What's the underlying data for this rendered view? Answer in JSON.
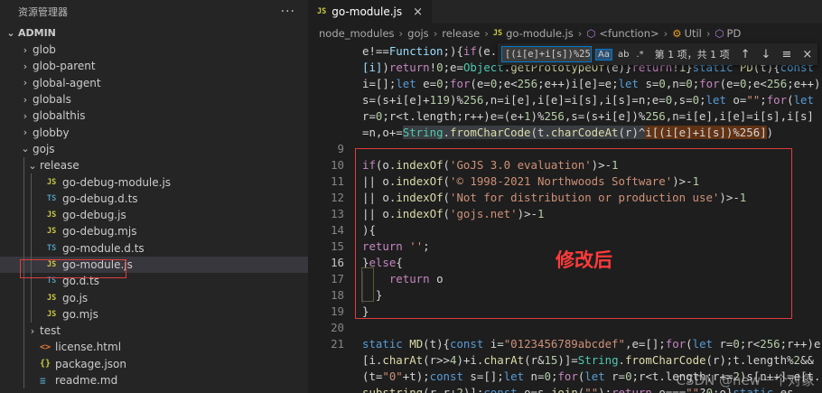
{
  "sidebar": {
    "title": "资源管理器",
    "more": "···",
    "section": "ADMIN",
    "items": [
      {
        "label": "glob",
        "depth": 1,
        "type": "folder",
        "open": false
      },
      {
        "label": "glob-parent",
        "depth": 1,
        "type": "folder",
        "open": false
      },
      {
        "label": "global-agent",
        "depth": 1,
        "type": "folder",
        "open": false
      },
      {
        "label": "globals",
        "depth": 1,
        "type": "folder",
        "open": false
      },
      {
        "label": "globalthis",
        "depth": 1,
        "type": "folder",
        "open": false
      },
      {
        "label": "globby",
        "depth": 1,
        "type": "folder",
        "open": false
      },
      {
        "label": "gojs",
        "depth": 1,
        "type": "folder",
        "open": true
      },
      {
        "label": "release",
        "depth": 2,
        "type": "folder",
        "open": true
      },
      {
        "label": "go-debug-module.js",
        "depth": 3,
        "type": "js"
      },
      {
        "label": "go-debug.d.ts",
        "depth": 3,
        "type": "ts"
      },
      {
        "label": "go-debug.js",
        "depth": 3,
        "type": "js"
      },
      {
        "label": "go-debug.mjs",
        "depth": 3,
        "type": "js"
      },
      {
        "label": "go-module.d.ts",
        "depth": 3,
        "type": "ts"
      },
      {
        "label": "go-module.js",
        "depth": 3,
        "type": "js",
        "selected": true
      },
      {
        "label": "go.d.ts",
        "depth": 3,
        "type": "ts"
      },
      {
        "label": "go.js",
        "depth": 3,
        "type": "js"
      },
      {
        "label": "go.mjs",
        "depth": 3,
        "type": "js"
      },
      {
        "label": "test",
        "depth": 2,
        "type": "folder",
        "open": false
      },
      {
        "label": "license.html",
        "depth": 2,
        "type": "html"
      },
      {
        "label": "package.json",
        "depth": 2,
        "type": "json"
      },
      {
        "label": "readme.md",
        "depth": 2,
        "type": "md"
      }
    ],
    "icon_text": {
      "js": "JS",
      "ts": "TS",
      "html": "<>",
      "json": "{}",
      "md": "≡"
    }
  },
  "editor": {
    "tab": {
      "label": "go-module.js",
      "icon": "JS",
      "close": "×"
    },
    "breadcrumb": [
      "node_modules",
      "gojs",
      "release",
      "go-module.js",
      "<function>",
      "Util",
      "PD"
    ],
    "find": {
      "query": "[(i[e]+i[s])%256])",
      "options": [
        "Aa",
        "ab",
        ".*"
      ],
      "count": "第 1 项，共 1 项"
    },
    "annotation": "修改后",
    "watermark": "CSDN @new一个对象"
  }
}
